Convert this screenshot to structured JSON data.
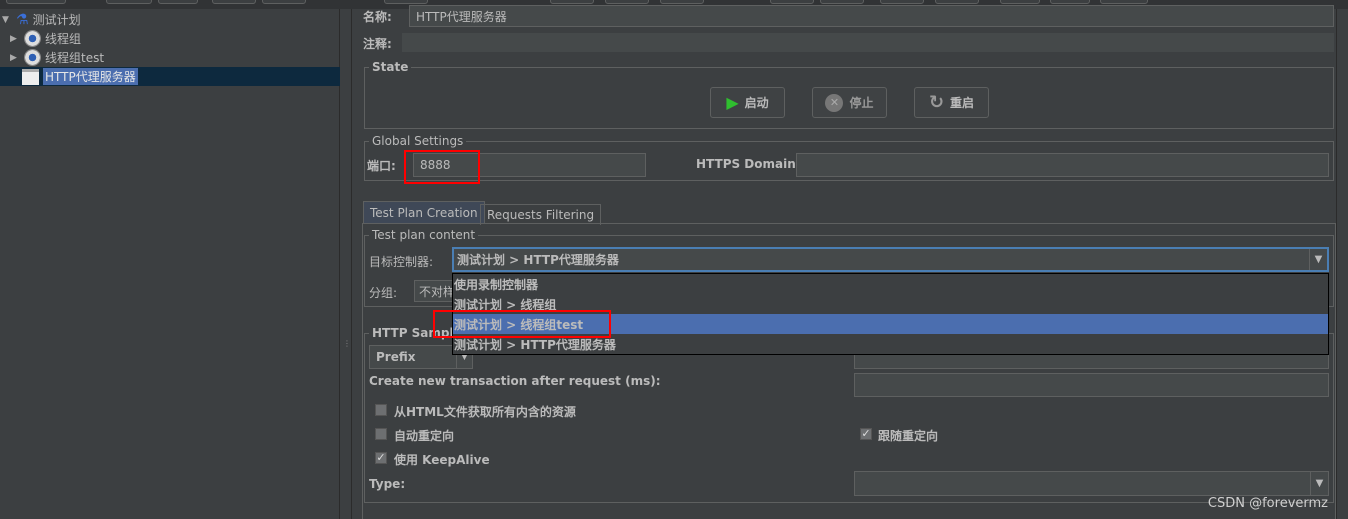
{
  "tree": {
    "root": "测试计划",
    "items": [
      {
        "label": "线程组",
        "icon": "gear-icon"
      },
      {
        "label": "线程组test",
        "icon": "gear-icon"
      },
      {
        "label": "HTTP代理服务器",
        "icon": "proxy-icon",
        "selected": true
      }
    ]
  },
  "form": {
    "name_label": "名称:",
    "name_value": "HTTP代理服务器",
    "comment_label": "注释:",
    "comment_value": ""
  },
  "state": {
    "title": "State",
    "start": "启动",
    "stop": "停止",
    "restart": "重启"
  },
  "global": {
    "title": "Global Settings",
    "port_label": "端口:",
    "port_value": "8888",
    "https_label": "HTTPS Domains:",
    "https_value": ""
  },
  "tabs": [
    {
      "label": "Test Plan Creation",
      "active": true
    },
    {
      "label": "Requests Filtering",
      "active": false
    }
  ],
  "content": {
    "title": "Test plan content",
    "target_label": "目标控制器:",
    "target_value": "测试计划 > HTTP代理服务器",
    "group_label": "分组:",
    "group_value": "不对样",
    "dropdown_options": [
      "使用录制控制器",
      "测试计划 > 线程组",
      "测试计划 > 线程组test",
      "测试计划 > HTTP代理服务器"
    ],
    "highlighted_option": 2
  },
  "sampler": {
    "title": "HTTP Sampler",
    "prefix_value": "Prefix",
    "transaction_label": "Create new transaction after request (ms):",
    "fetch_resources": {
      "label": "从HTML文件获取所有内含的资源",
      "checked": false
    },
    "auto_redirect": {
      "label": "自动重定向",
      "checked": false
    },
    "follow_redirect": {
      "label": "跟随重定向",
      "checked": true
    },
    "keepalive": {
      "label": "使用 KeepAlive",
      "checked": true
    },
    "type_label": "Type:"
  },
  "watermark": "CSDN @forevermz",
  "colors": {
    "selection": "#4b6eaf",
    "highlight_box": "#ff0000",
    "background": "#3c3f41"
  }
}
